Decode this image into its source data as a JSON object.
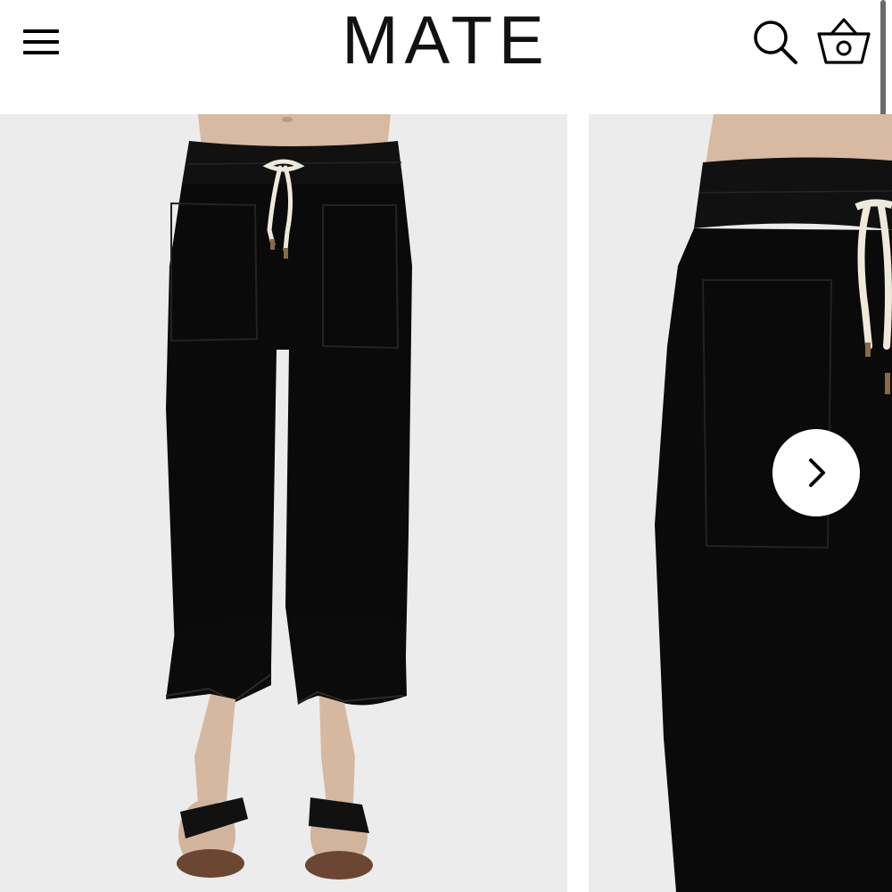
{
  "header": {
    "brand": "MATE",
    "menu_icon": "hamburger-menu-icon",
    "search_icon": "search-icon",
    "cart_icon": "shopping-basket-icon"
  },
  "gallery": {
    "slides": [
      {
        "name": "product-photo-full-length"
      },
      {
        "name": "product-photo-pocket-detail"
      }
    ],
    "next_icon": "chevron-right-icon"
  },
  "colors": {
    "background": "#ffffff",
    "photo_backdrop": "#ececec",
    "product": "#0b0b0b",
    "drawstring": "#efe9dc",
    "skin": "#d7b9a3"
  }
}
